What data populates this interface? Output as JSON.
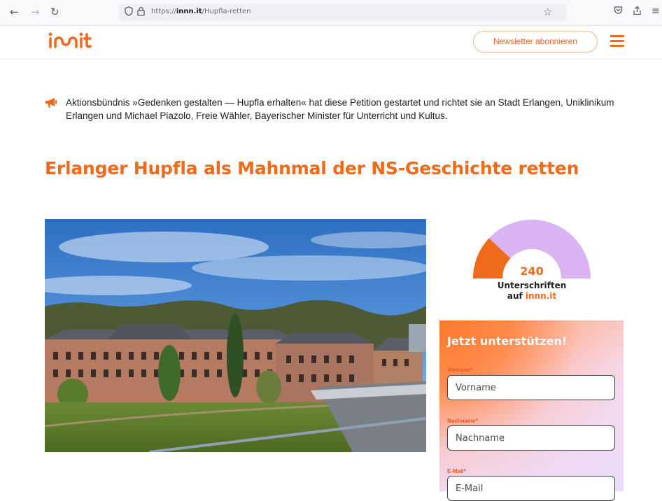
{
  "browser": {
    "url_prefix": "https://",
    "url_domain": "innn.it",
    "url_path": "/Hupfla-retten"
  },
  "header": {
    "logo": "innit",
    "newsletter_label": "Newsletter abonnieren"
  },
  "petition": {
    "starter_text": "Aktionsbündnis »Gedenken gestalten — Hupfla erhalten« hat diese Petition gestartet und richtet sie an Stadt Erlangen, Uniklinikum Erlangen und Michael Piazolo, Freie Wähler, Bayerischer Minister für Unterricht und Kultus.",
    "title": "Erlanger Hupfla als Mahnmal der NS-Geschichte retten"
  },
  "signatures": {
    "count": "240",
    "label_line1": "Unterschriften",
    "label_prefix": "auf ",
    "label_brand": "innn.it",
    "progress_fraction": 0.24
  },
  "form": {
    "title": "Jetzt unterstützen!",
    "first_name_label": "Vorname*",
    "first_name_placeholder": "Vorname",
    "last_name_label": "Nachname*",
    "last_name_placeholder": "Nachname",
    "email_label": "E-Mail*",
    "email_placeholder": "E-Mail"
  },
  "colors": {
    "brand_orange": "#f06a1c",
    "gauge_track": "#d9b3f2"
  }
}
